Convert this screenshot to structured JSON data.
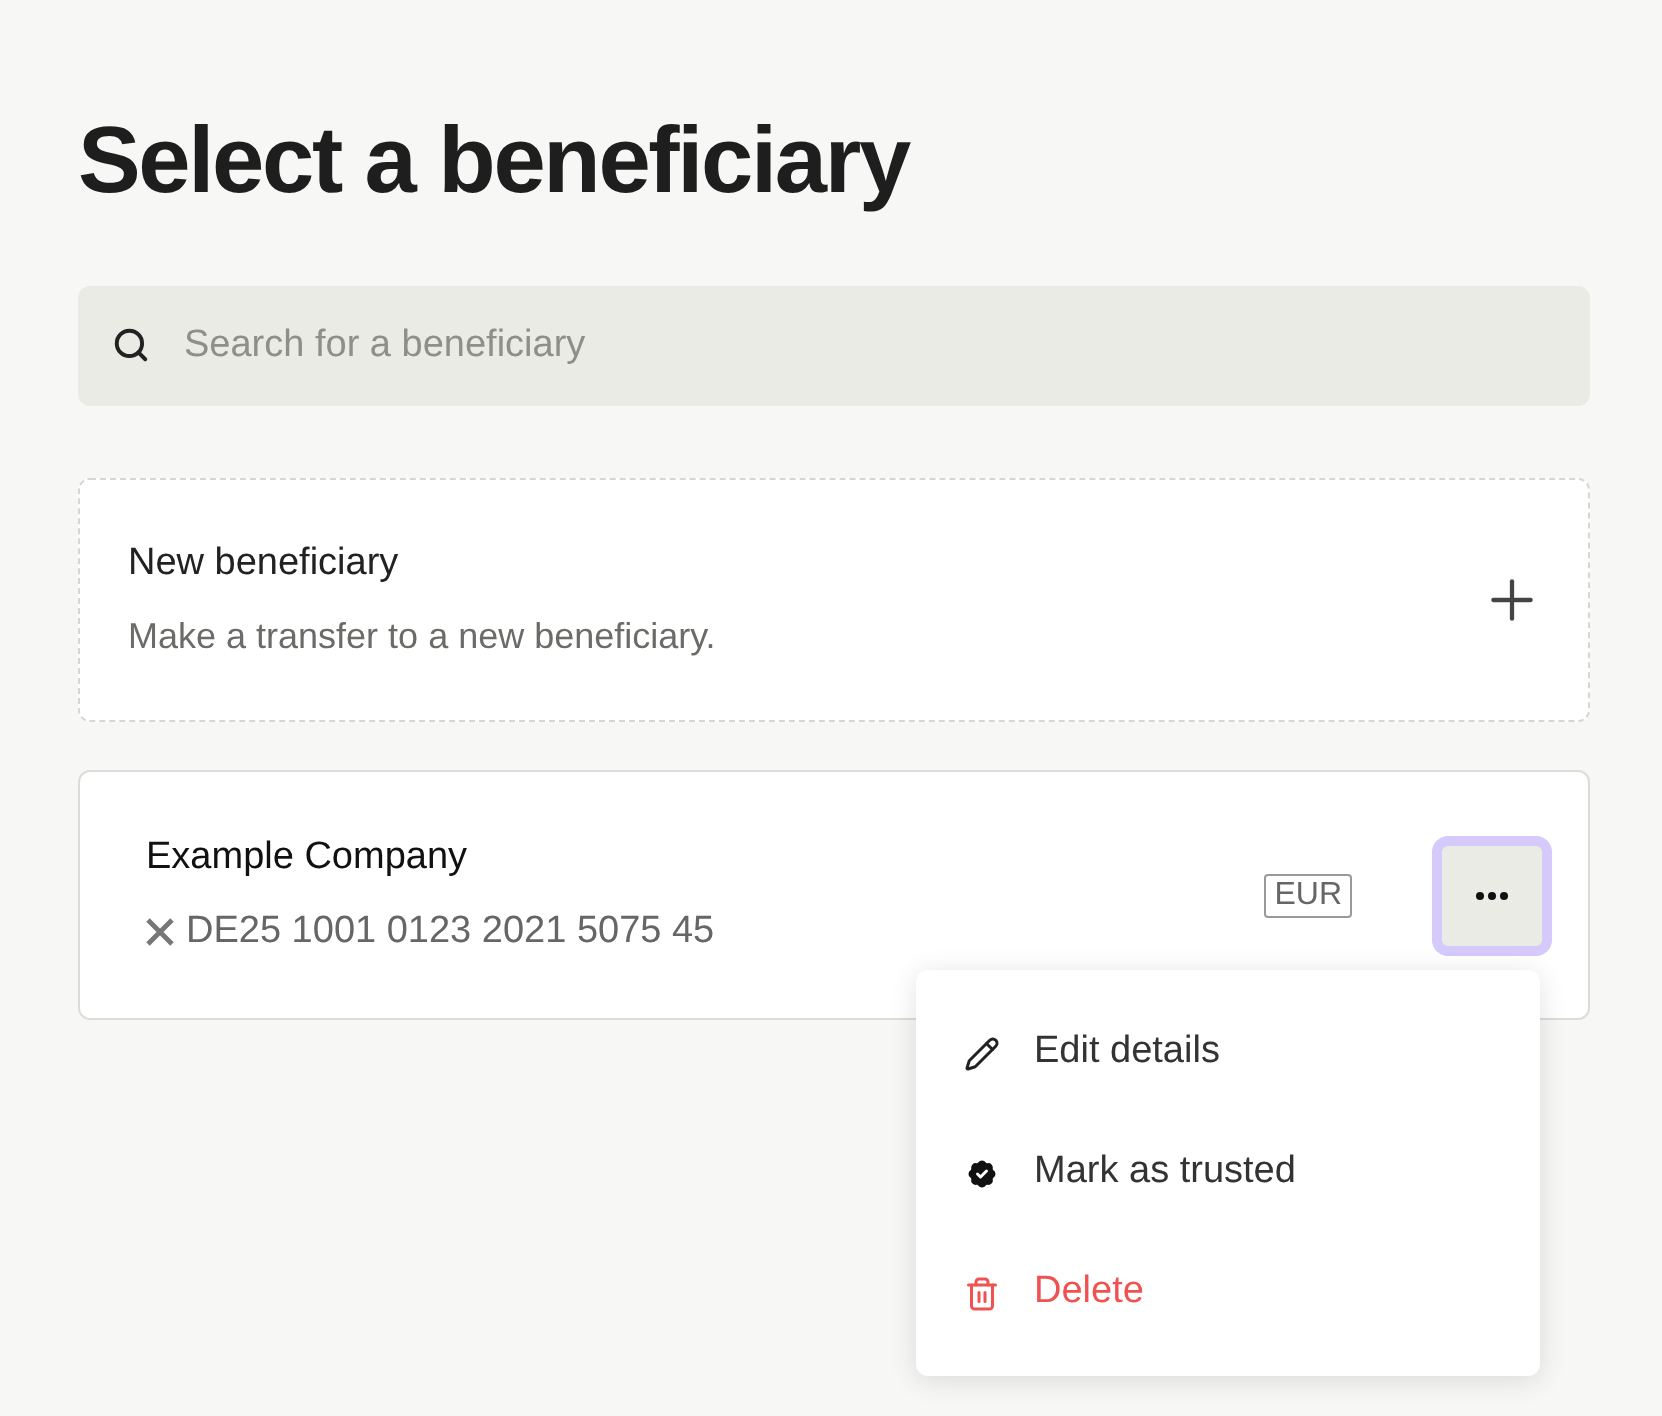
{
  "title": "Select a beneficiary",
  "search": {
    "placeholder": "Search for a beneficiary"
  },
  "new_beneficiary": {
    "title": "New beneficiary",
    "subtitle": "Make a transfer to a new beneficiary."
  },
  "beneficiaries": [
    {
      "name": "Example Company",
      "iban": "DE25 1001 0123 2021 5075 45",
      "currency": "EUR",
      "menu_expanded": true
    }
  ],
  "menu": [
    {
      "kind": "edit",
      "label": "Edit details"
    },
    {
      "kind": "trusted",
      "label": "Mark as trusted"
    },
    {
      "kind": "delete",
      "label": "Delete"
    }
  ]
}
